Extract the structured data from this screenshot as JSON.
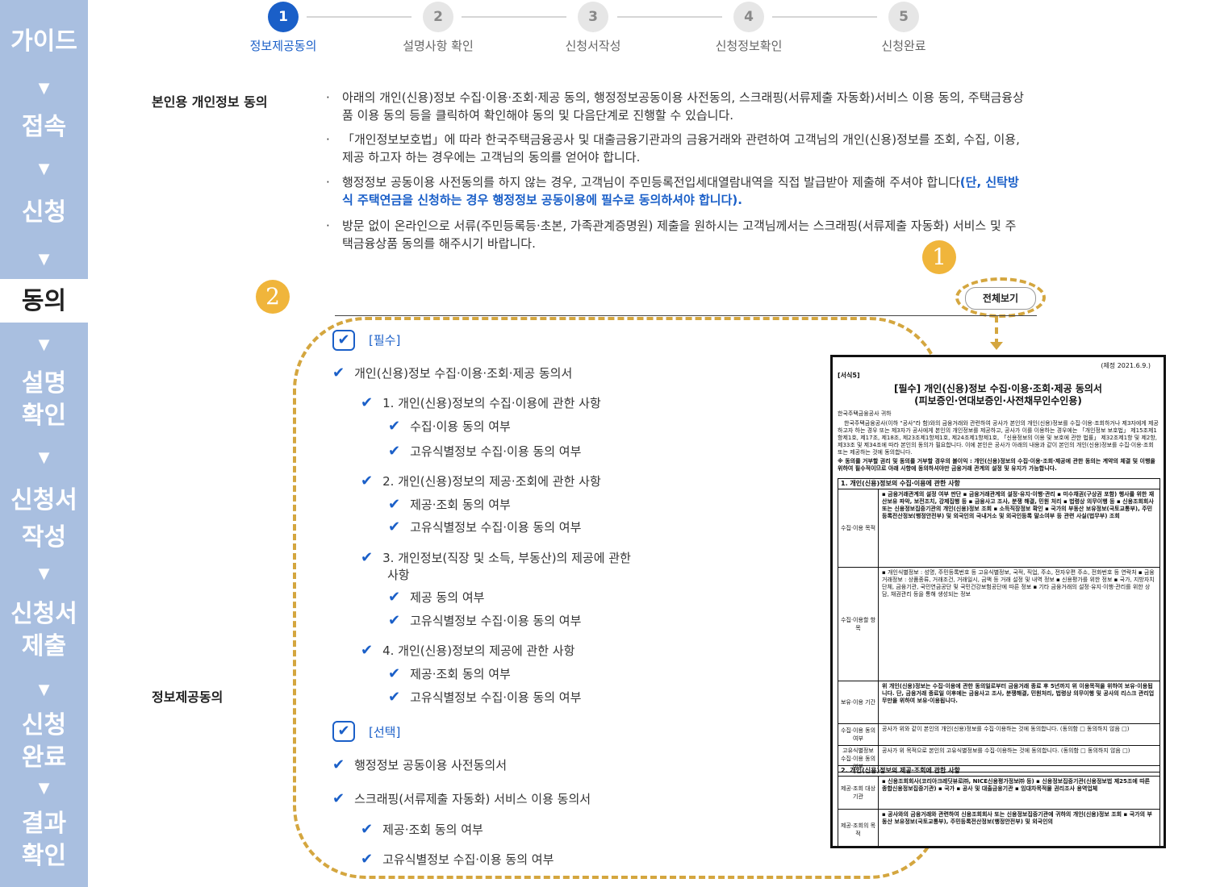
{
  "sidebar": {
    "items": [
      {
        "label": "가이드"
      },
      {
        "label": "접속"
      },
      {
        "label": "신청"
      },
      {
        "label": "동의"
      },
      {
        "label": "설명\n확인"
      },
      {
        "label": "신청서\n작성"
      },
      {
        "label": "신청서\n제출"
      },
      {
        "label": "신청\n완료"
      },
      {
        "label": "결과\n확인"
      }
    ],
    "arrow": "▼",
    "active_index": 3
  },
  "steps": [
    {
      "num": "1",
      "label": "정보제공동의",
      "active": true
    },
    {
      "num": "2",
      "label": "설명사항 확인",
      "active": false
    },
    {
      "num": "3",
      "label": "신청서작성",
      "active": false
    },
    {
      "num": "4",
      "label": "신청정보확인",
      "active": false
    },
    {
      "num": "5",
      "label": "신청완료",
      "active": false
    }
  ],
  "personal_consent": {
    "title": "본인용 개인정보 동의",
    "bullets": [
      "아래의 개인(신용)정보 수집·이용·조회·제공 동의, 행정정보공동이용 사전동의, 스크래핑(서류제출 자동화)서비스 이용 동의, 주택금융상품 이용 동의 등을 클릭하여 확인해야 동의 및 다음단계로 진행할 수 있습니다.",
      "「개인정보보호법」에 따라 한국주택금융공사 및 대출금융기관과의 금융거래와 관련하여 고객님의 개인(신용)정보를 조회, 수집, 이용, 제공 하고자 하는 경우에는 고객님의 동의를 얻어야 합니다.",
      "방문 없이 온라인으로 서류(주민등록등·초본, 가족관계증명원) 제출을 원하시는 고객님께서는 스크래핑(서류제출 자동화) 서비스 및 주택금융상품 동의를 해주시기 바랍니다."
    ],
    "bullet3_prefix": "행정정보 공동이용 사전동의를 하지 않는 경우, 고객님이 주민등록전입세대열람내역을 직접 발급받아 제출해 주셔야 합니다",
    "bullet3_highlight": "(단, 신탁방식 주택연금을 신청하는 경우 행정정보 공동이용에 필수로 동의하셔야 합니다)."
  },
  "badges": {
    "one": "1",
    "two": "2"
  },
  "view_all_label": "전체보기",
  "info_consent_title": "정보제공동의",
  "consent": {
    "required_tag": "[필수]",
    "optional_tag": "[선택]",
    "check_glyph": "✔",
    "required_items": [
      "개인(신용)정보 수집·이용·조회·제공 동의서",
      "1. 개인(신용)정보의 수집·이용에 관한 사항",
      "수집·이용 동의 여부",
      "고유식별정보 수집·이용 동의 여부",
      "2. 개인(신용)정보의 제공·조회에 관한 사항",
      "제공·조회 동의 여부",
      "고유식별정보 수집·이용 동의 여부",
      "3. 개인정보(직장 및 소득, 부동산)의 제공에 관한",
      "사항",
      "제공 동의 여부",
      "고유식별정보 수집·이용 동의 여부",
      "4. 개인(신용)정보의 제공에 관한 사항",
      "제공·조회 동의 여부",
      "고유식별정보 수집·이용 동의 여부"
    ],
    "optional_items": [
      "행정정보 공동이용 사전동의서",
      "스크래핑(서류제출 자동화) 서비스 이용 동의서",
      "제공·조회 동의 여부",
      "고유식별정보 수집·이용 동의 여부"
    ]
  },
  "document": {
    "revision": "(제정 2021.6.9.)",
    "form_no": "[서식5]",
    "title_line1": "[필수] 개인(신용)정보 수집·이용·조회·제공 동의서",
    "title_line2": "(피보증인·연대보증인·사전채무인수인용)",
    "addressee": "한국주택금융공사 귀하",
    "intro": "한국주택금융공사(이하 \"공사\"라 함)와의 금융거래와 관련하여 공사가 본인의 개인(신용)정보를 수집·이용·조회하거나 제3자에게 제공하고자 하는 경우 또는 제3자가 공사에게 본인의 개인정보를 제공하고, 공사가 이를 이용하는 경우에는 「개인정보 보호법」 제15조제1항제1호, 제17조, 제18조, 제23조제1항제1호, 제24조제1항제1호, 「신용정보의 이용 및 보호에 관한 법률」 제32조제1항 및 제2항, 제33조 및 제34조에 따라 본인의 동의가 필요합니다. 이에 본인은 공사가 아래의 내용과 같이 본인의 개인(신용)정보를 수집·이용·조회 또는 제공하는 것에 동의합니다.",
    "refuse_note": "※ 동의를 거부할 권리 및 동의를 거부할 경우의 불이익 : 개인(신용)정보의 수집·이용·조회·제공에 관한 동의는 계약의 체결 및 이행을 위하여 필수적이므로 아래 사항에 동의하셔야만 금융거래 관계의 설정 및 유지가 가능합니다.",
    "sec1_head": "1. 개인(신용)정보의 수집·이용에 관한 사항",
    "sec1_rows": [
      {
        "key": "수집·이용 목적",
        "val": "▪ 금융거래관계의 설정 여부 판단 ▪ 금융거래관계의 설정·유지·이행·관리 ▪ 미수채권(구상권 포함) 행사를 위한 재산보유 파악, 보전조치, 강제집행 등 ▪ 금융사고 조사, 분쟁 해결, 민원 처리 ▪ 법령상 의무이행 등 ▪ 신용조회회사 또는 신용정보집중기관의 개인(신용)정보 조회 ▪ 소득직장정보 확인 ▪ 국가의 부동산 보유정보(국토교통부), 주민등록전산정보(행정안전부) 및 외국인의 국내거소 및 외국인등록 말소여부 등 관련 사실(법무부) 조회"
      },
      {
        "key": "수집·이용할 항목",
        "val": "▪ 개인식별정보 : 성명, 주민등록번호 등 고유식별정보, 국적, 직업, 주소, 전자우편 주소, 전화번호 등 연락처 ▪ 금융거래정보 : 상품종류, 거래조건, 거래일시, 금액 등 거래 설정 및 내역 정보 ▪ 신용평가를 위한 정보 ▪ 국가, 지방자치단체, 금융기관, 국민연금공단 및 국민건강보험공단에 따른 정보 ▪ 기타 금융거래의 설정·유지·이행·관리를 위한 상담, 채권관리 등을 통해 생성되는 정보"
      },
      {
        "key": "보유·이용 기간",
        "val": "위 개인(신용)정보는 수집·이용에 관한 동의일로부터 금융거래 종료 후 5년까지 위 이용목적을 위하여 보유·이용됩니다. 단, 금융거래 종료일 이후에는 금융사고 조사, 분쟁해결, 민원처리, 법령상 의무이행 및 공사의 리스크 관리업무만을 위하여 보유·이용됩니다."
      },
      {
        "key": "수집·이용 동의 여부",
        "val": "공사가 위와 같이 본인의 개인(신용)정보를 수집·이용하는 것에 동의합니다. (동의함 □ 동의하지 않음 □)"
      },
      {
        "key": "고유식별정보 수집·이용 동의여부",
        "val": "공사가 위 목적으로 본인의 고유식별정보를 수집·이용하는 것에 동의합니다. (동의함 □ 동의하지 않음 □)"
      }
    ],
    "sec2_head": "2. 개인(신용)정보의 제공·조회에 관한 사항",
    "sec2_rows": [
      {
        "key": "제공·조회 대상기관",
        "val": "▪ 신용조회회사(코리아크레딧뷰로㈜, NICE신용평가정보㈜ 등) ▪ 신용정보집중기관(신용정보법 제25조에 따른 종합신용정보집중기관) ▪ 국가 ▪ 공사 및 대출금융기관 ▪ 임대차목적물 권리조사 용역업체"
      },
      {
        "key": "제공·조회의 목적",
        "val": "▪ 공사와의 금융거래와 관련하여 신용조회회사 또는 신용정보집중기관에 귀하의 개인(신용)정보 조회 ▪ 국가의 부동산 보유정보(국토교통부), 주민등록전산정보(행정안전부) 및 외국인의"
      }
    ]
  }
}
